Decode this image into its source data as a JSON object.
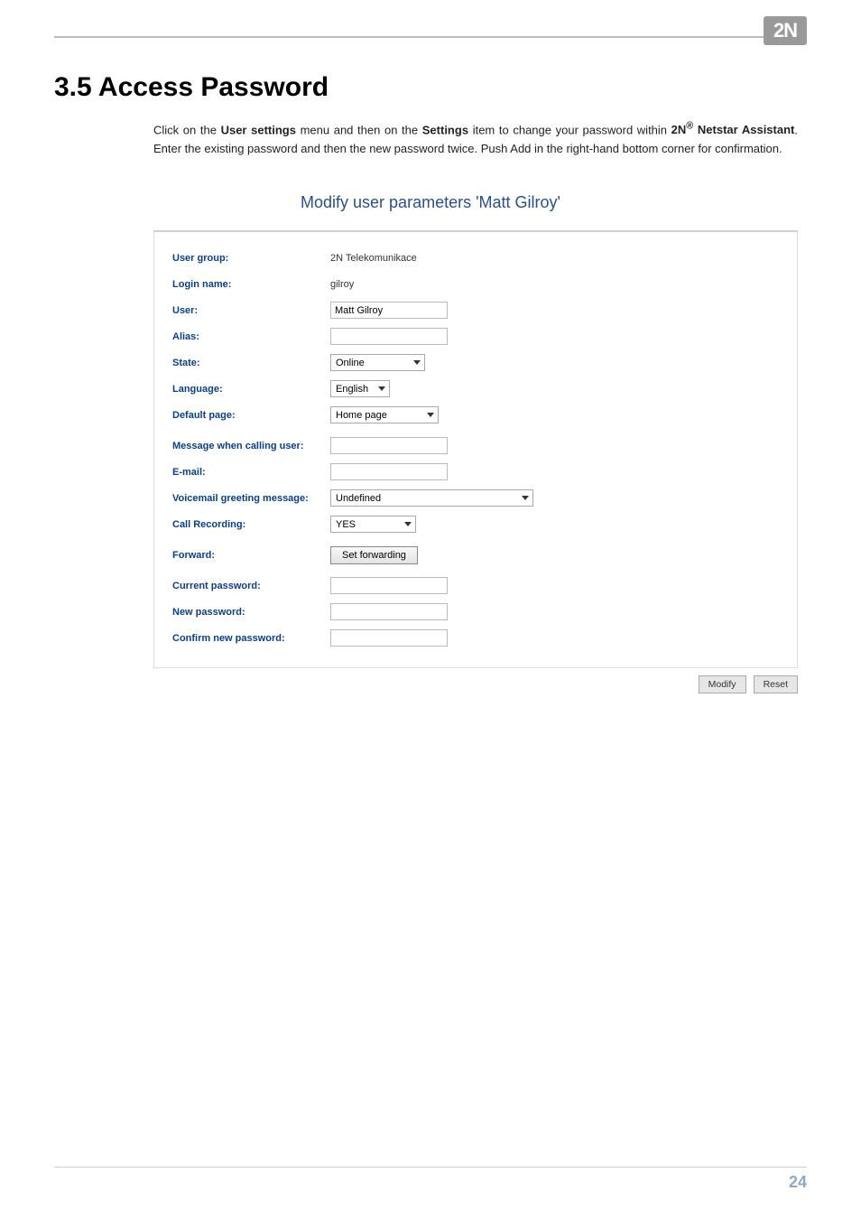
{
  "logo_text": "2N",
  "heading": "3.5 Access Password",
  "intro": {
    "p1a": "Click on the ",
    "b1": "User settings",
    "p1b": " menu and then on the ",
    "b2": "Settings",
    "p1c": " item to change your password within ",
    "b3a": "2N",
    "b3sup": "®",
    "b3b": " Netstar Assistant",
    "p1d": ". Enter the existing password and then the new password twice. Push Add in the right-hand bottom corner for confirmation."
  },
  "panel_title": "Modify user parameters 'Matt Gilroy'",
  "form": {
    "user_group": {
      "label": "User group:",
      "value": "2N Telekomunikace"
    },
    "login_name": {
      "label": "Login name:",
      "value": "gilroy"
    },
    "user": {
      "label": "User:",
      "value": "Matt Gilroy"
    },
    "alias": {
      "label": "Alias:",
      "value": ""
    },
    "state": {
      "label": "State:",
      "value": "Online"
    },
    "language": {
      "label": "Language:",
      "value": "English"
    },
    "default_page": {
      "label": "Default page:",
      "value": "Home page"
    },
    "message_calling": {
      "label": "Message when calling user:",
      "value": ""
    },
    "email": {
      "label": "E-mail:",
      "value": ""
    },
    "voicemail_greeting": {
      "label": "Voicemail greeting message:",
      "value": "Undefined"
    },
    "call_recording": {
      "label": "Call Recording:",
      "value": "YES"
    },
    "forward": {
      "label": "Forward:",
      "button": "Set forwarding"
    },
    "current_password": {
      "label": "Current password:",
      "value": ""
    },
    "new_password": {
      "label": "New password:",
      "value": ""
    },
    "confirm_password": {
      "label": "Confirm new password:",
      "value": ""
    }
  },
  "buttons": {
    "modify": "Modify",
    "reset": "Reset"
  },
  "page_number": "24"
}
